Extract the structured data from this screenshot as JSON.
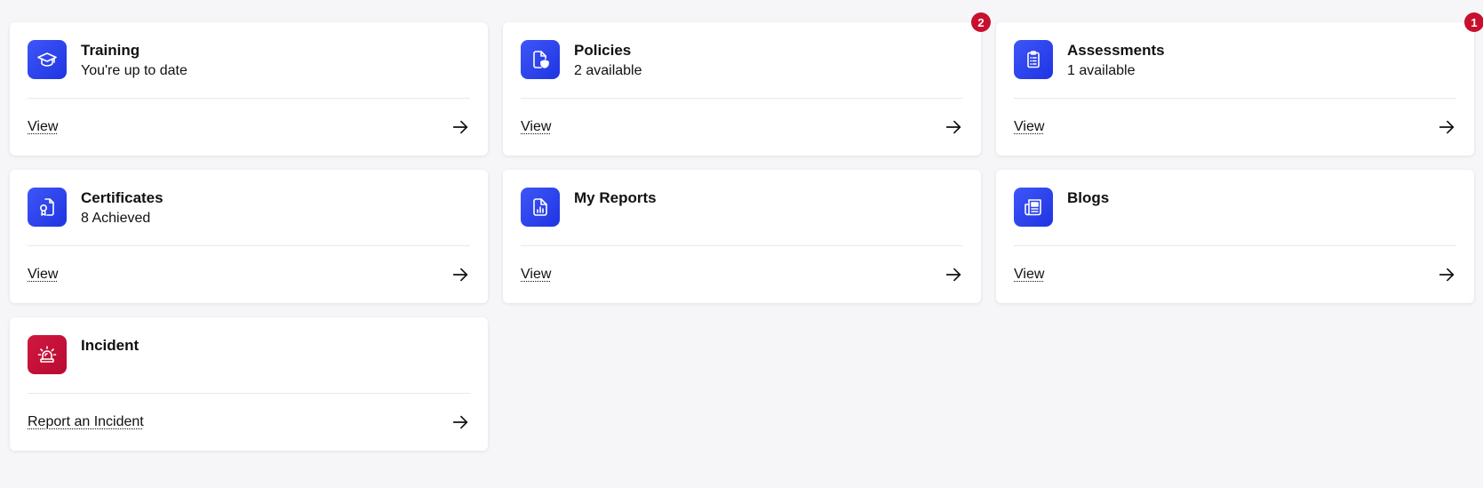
{
  "colors": {
    "accent": "#2a40ee",
    "danger": "#c8102e",
    "background": "#f6f6f8",
    "card": "#ffffff"
  },
  "cards": [
    {
      "title": "Training",
      "subtitle": "You're up to date",
      "link": "View",
      "icon": "graduation-cap-icon"
    },
    {
      "title": "Policies",
      "subtitle": "2 available",
      "link": "View",
      "icon": "policy-document-shield-icon",
      "badge": "2"
    },
    {
      "title": "Assessments",
      "subtitle": "1 available",
      "link": "View",
      "icon": "clipboard-list-icon",
      "badge": "1"
    },
    {
      "title": "Certificates",
      "subtitle": "8 Achieved",
      "link": "View",
      "icon": "certificate-document-icon"
    },
    {
      "title": "My Reports",
      "subtitle": "",
      "link": "View",
      "icon": "report-chart-document-icon"
    },
    {
      "title": "Blogs",
      "subtitle": "",
      "link": "View",
      "icon": "newspaper-icon"
    },
    {
      "title": "Incident",
      "subtitle": "",
      "link": "Report an Incident",
      "icon": "siren-alarm-icon"
    }
  ]
}
